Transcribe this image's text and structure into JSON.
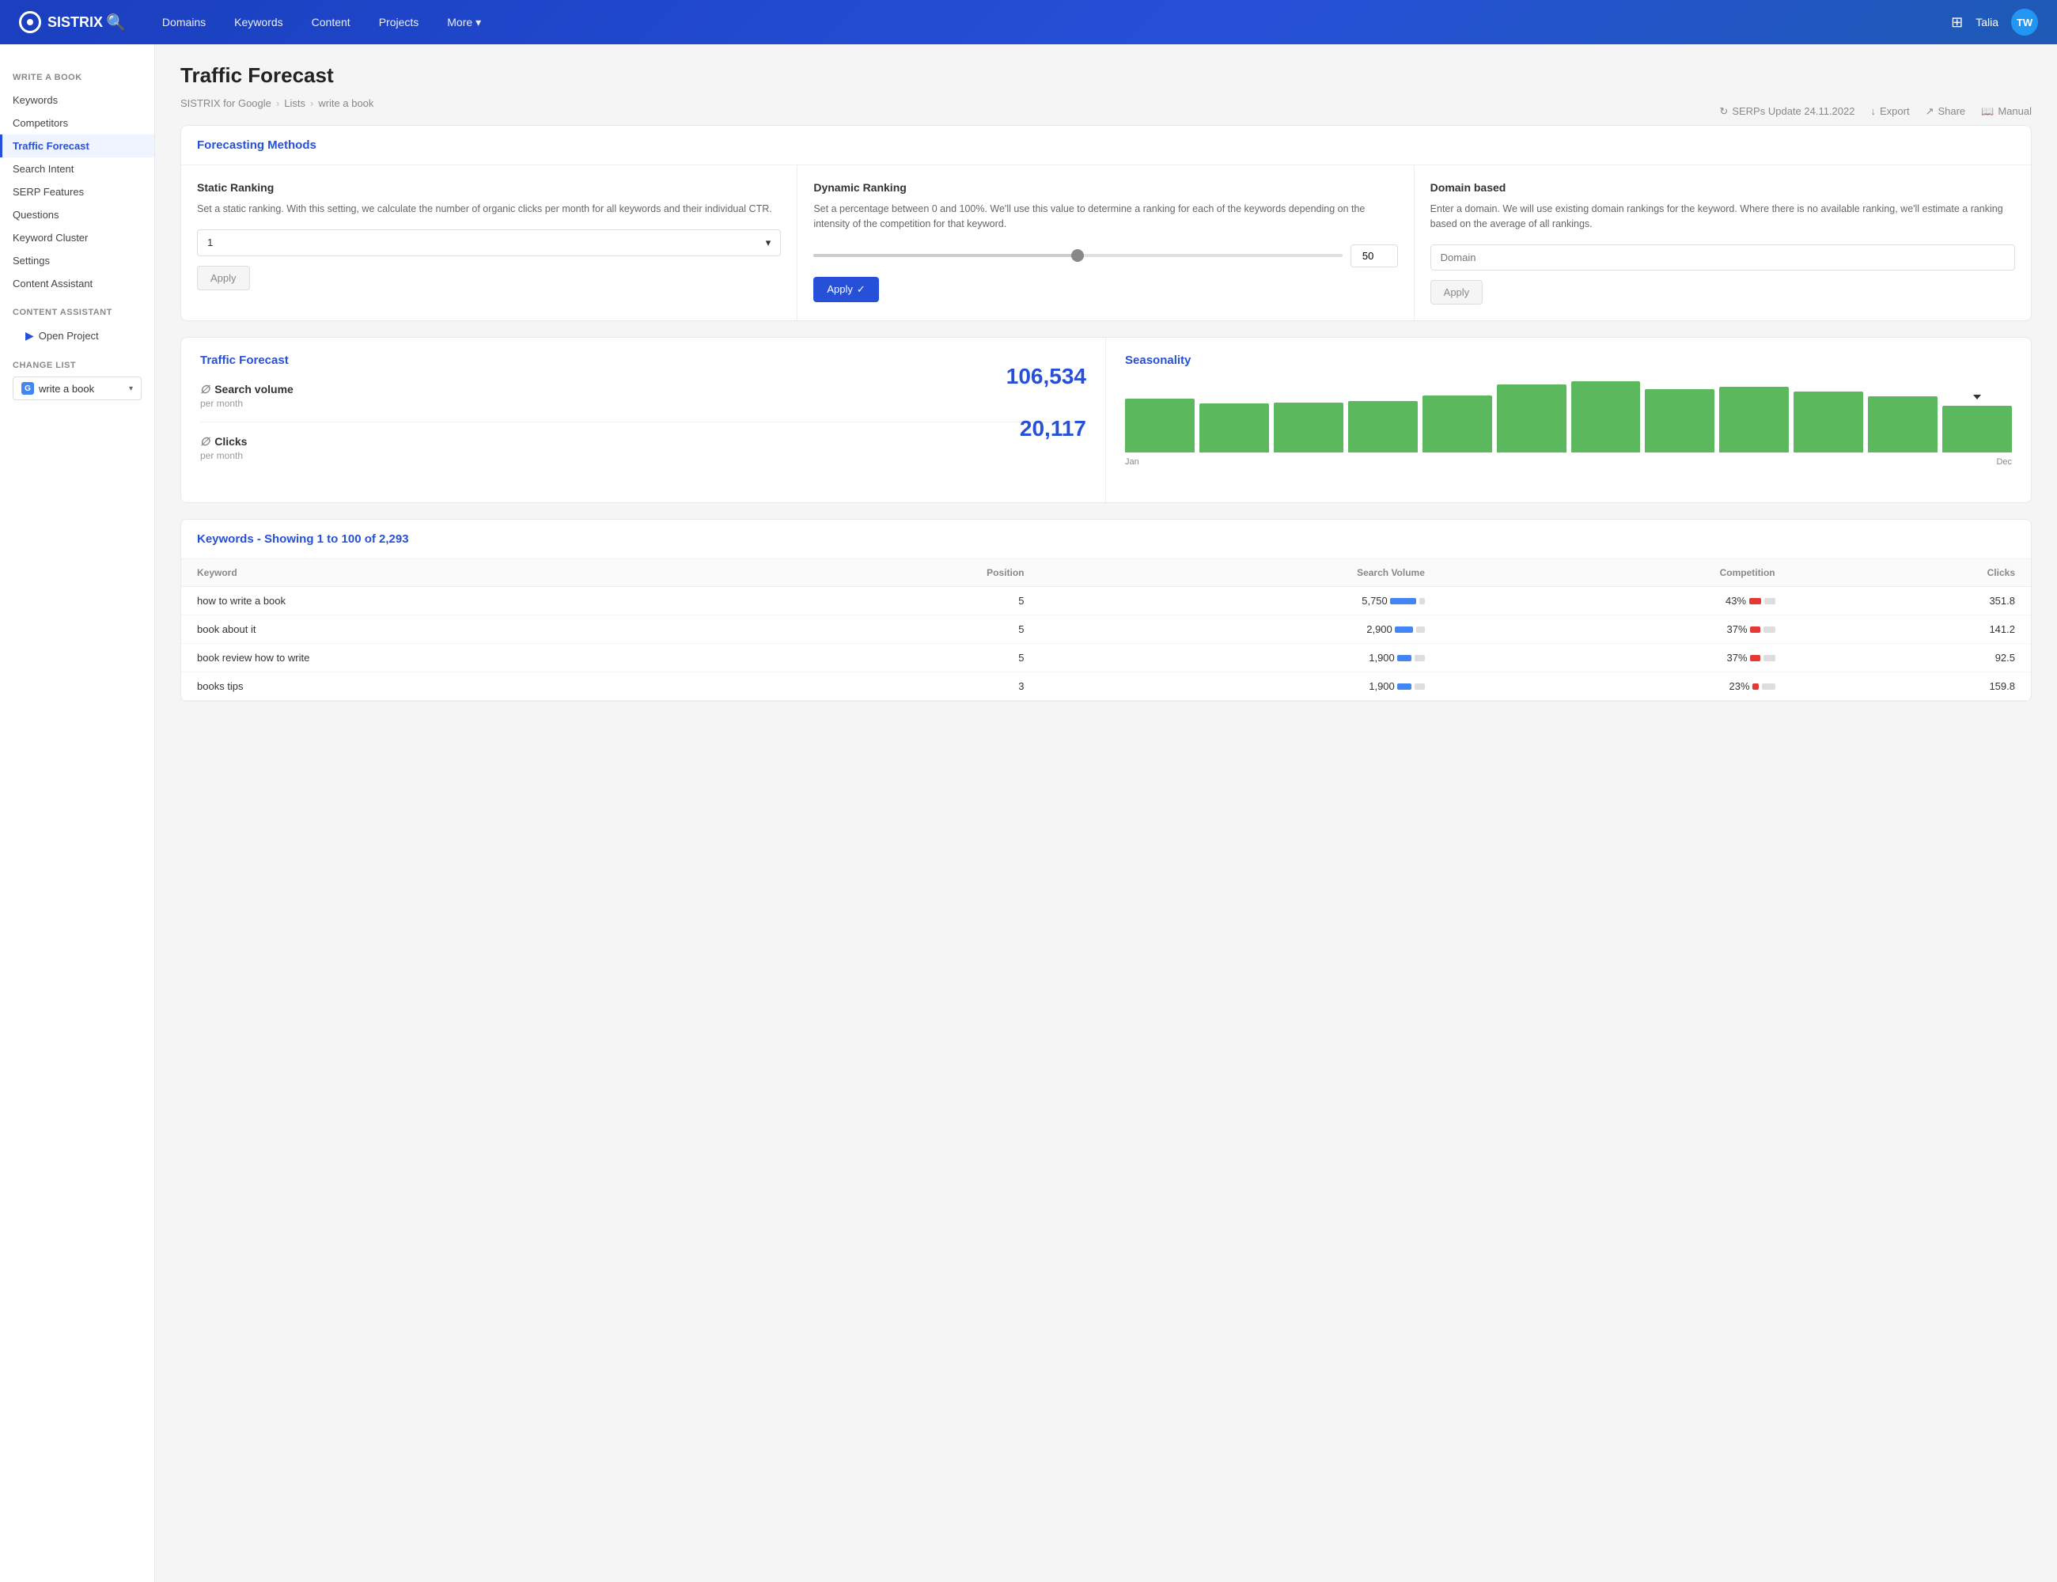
{
  "header": {
    "logo_text": "SISTRIX",
    "nav_items": [
      "Domains",
      "Keywords",
      "Content",
      "Projects",
      "More"
    ],
    "user_name": "Talia",
    "user_initials": "TW"
  },
  "sidebar": {
    "write_a_book_title": "WRITE A BOOK",
    "items": [
      {
        "label": "Keywords",
        "active": false
      },
      {
        "label": "Competitors",
        "active": false
      },
      {
        "label": "Traffic Forecast",
        "active": true
      },
      {
        "label": "Search Intent",
        "active": false
      },
      {
        "label": "SERP Features",
        "active": false
      },
      {
        "label": "Questions",
        "active": false
      },
      {
        "label": "Keyword Cluster",
        "active": false
      },
      {
        "label": "Settings",
        "active": false
      },
      {
        "label": "Content Assistant",
        "active": false
      }
    ],
    "content_assistant_title": "CONTENT ASSISTANT",
    "open_project": "Open Project",
    "change_list_title": "CHANGE LIST",
    "list_label": "write a book"
  },
  "breadcrumb": {
    "items": [
      "SISTRIX for Google",
      "Lists",
      "write a book"
    ],
    "serps_update": "SERPs Update 24.11.2022",
    "export": "Export",
    "share": "Share",
    "manual": "Manual"
  },
  "page_title": "Traffic Forecast",
  "forecasting": {
    "section_title": "Forecasting Methods",
    "static_ranking": {
      "title": "Static Ranking",
      "desc": "Set a static ranking. With this setting, we calculate the number of organic clicks per month for all keywords and their individual CTR.",
      "select_value": "1",
      "apply_label": "Apply"
    },
    "dynamic_ranking": {
      "title": "Dynamic Ranking",
      "desc": "Set a percentage between 0 and 100%. We'll use this value to determine a ranking for each of the keywords depending on the intensity of the competition for that keyword.",
      "slider_value": 50,
      "apply_label": "Apply",
      "check": true
    },
    "domain_based": {
      "title": "Domain based",
      "desc": "Enter a domain. We will use existing domain rankings for the keyword. Where there is no available ranking, we'll estimate a ranking based on the average of all rankings.",
      "placeholder": "Domain",
      "apply_label": "Apply"
    }
  },
  "traffic_forecast": {
    "title": "Traffic Forecast",
    "search_volume_label": "Search volume",
    "search_volume_sub": "per month",
    "search_volume_value": "106,534",
    "clicks_label": "Clicks",
    "clicks_sub": "per month",
    "clicks_value": "20,117"
  },
  "seasonality": {
    "title": "Seasonality",
    "bars": [
      75,
      68,
      70,
      72,
      80,
      95,
      100,
      88,
      92,
      85,
      78,
      65
    ],
    "labels": [
      "Jan",
      "Dec"
    ],
    "active_bar_index": 11
  },
  "keywords_table": {
    "title": "Keywords - Showing 1 to 100 of 2,293",
    "columns": [
      "Keyword",
      "Position",
      "Search Volume",
      "Competition",
      "Clicks"
    ],
    "rows": [
      {
        "keyword": "how to write a book",
        "position": 5,
        "search_volume": "5,750",
        "sv_bar_pct": 65,
        "competition": "43%",
        "comp_bar_pct": 30,
        "clicks": "351.8"
      },
      {
        "keyword": "book about it",
        "position": 5,
        "search_volume": "2,900",
        "sv_bar_pct": 45,
        "competition": "37%",
        "comp_bar_pct": 25,
        "clicks": "141.2"
      },
      {
        "keyword": "book review how to write",
        "position": 5,
        "search_volume": "1,900",
        "sv_bar_pct": 35,
        "competition": "37%",
        "comp_bar_pct": 25,
        "clicks": "92.5"
      },
      {
        "keyword": "books tips",
        "position": 3,
        "search_volume": "1,900",
        "sv_bar_pct": 35,
        "competition": "23%",
        "comp_bar_pct": 15,
        "clicks": "159.8"
      }
    ]
  }
}
